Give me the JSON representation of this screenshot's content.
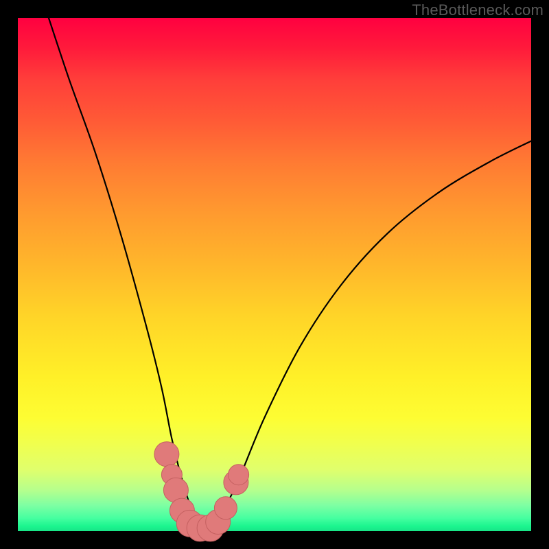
{
  "watermark": "TheBottleneck.com",
  "colors": {
    "black": "#000000",
    "curve": "#000000",
    "marker_fill": "#e07a7a",
    "marker_stroke": "#c46060",
    "gradient_top": "#ff0040",
    "gradient_bottom": "#18e588"
  },
  "chart_data": {
    "type": "line",
    "title": "",
    "xlabel": "",
    "ylabel": "",
    "xlim": [
      0,
      100
    ],
    "ylim": [
      0,
      100
    ],
    "grid": false,
    "legend": false,
    "note": "Axes are unlabeled in the image; x and y are normalized 0–100 estimates.",
    "series": [
      {
        "name": "bottleneck-curve",
        "x": [
          6,
          10,
          15,
          20,
          25,
          28,
          30,
          32,
          34,
          36,
          38,
          40,
          43,
          48,
          55,
          63,
          72,
          82,
          92,
          100
        ],
        "y": [
          100,
          88,
          74,
          58,
          40,
          28,
          18,
          10,
          4,
          1,
          1,
          4,
          10,
          22,
          36,
          48,
          58,
          66,
          72,
          76
        ]
      }
    ],
    "markers": [
      {
        "x": 29.0,
        "y": 15.0,
        "r": 2.4
      },
      {
        "x": 30.0,
        "y": 11.0,
        "r": 2.0
      },
      {
        "x": 30.8,
        "y": 8.0,
        "r": 2.4
      },
      {
        "x": 32.0,
        "y": 4.0,
        "r": 2.4
      },
      {
        "x": 33.5,
        "y": 1.5,
        "r": 2.6
      },
      {
        "x": 35.5,
        "y": 0.6,
        "r": 2.6
      },
      {
        "x": 37.5,
        "y": 0.6,
        "r": 2.6
      },
      {
        "x": 39.0,
        "y": 1.8,
        "r": 2.4
      },
      {
        "x": 40.5,
        "y": 4.5,
        "r": 2.2
      },
      {
        "x": 42.5,
        "y": 9.5,
        "r": 2.4
      },
      {
        "x": 43.0,
        "y": 11.0,
        "r": 2.0
      }
    ]
  }
}
